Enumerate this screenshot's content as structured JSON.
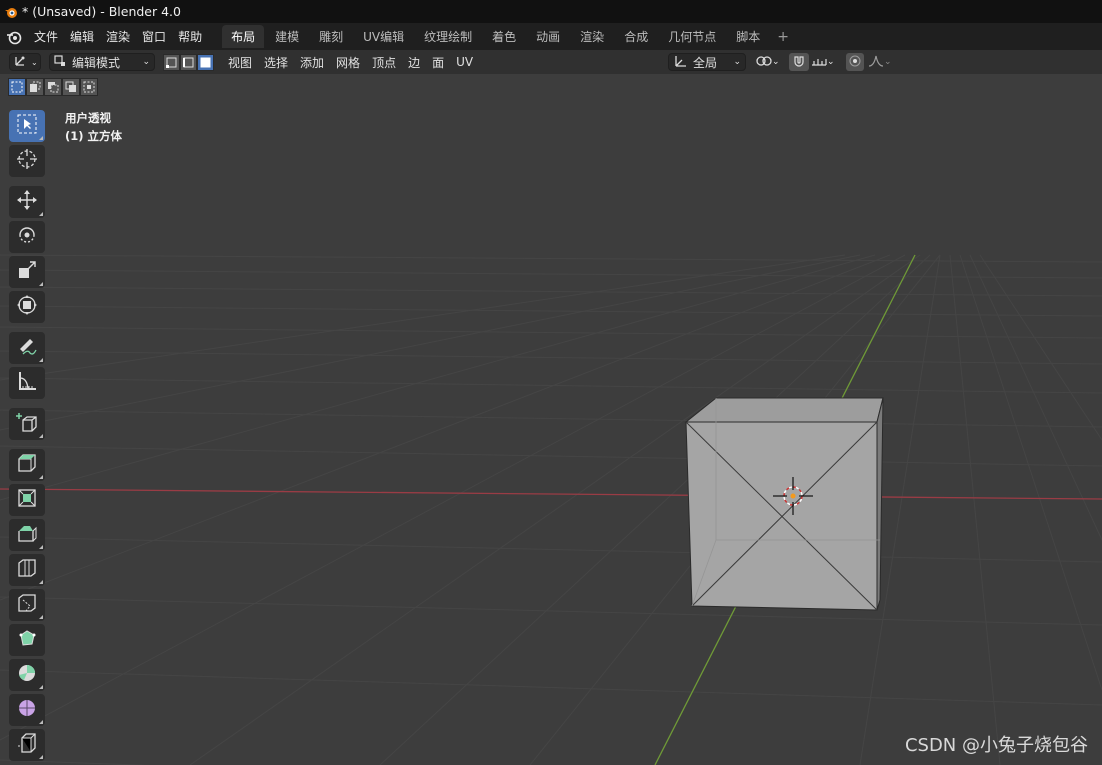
{
  "window": {
    "title": "* (Unsaved) - Blender 4.0"
  },
  "menubar": {
    "menus": [
      "文件",
      "编辑",
      "渲染",
      "窗口",
      "帮助"
    ],
    "tabs": [
      "布局",
      "建模",
      "雕刻",
      "UV编辑",
      "纹理绘制",
      "着色",
      "动画",
      "渲染",
      "合成",
      "几何节点",
      "脚本"
    ],
    "active_tab": "布局",
    "add_tab": "+"
  },
  "header": {
    "mode": "编辑模式",
    "menus": [
      "视图",
      "选择",
      "添加",
      "网格",
      "顶点",
      "边",
      "面",
      "UV"
    ],
    "transform_orientation": "全局"
  },
  "viewport": {
    "overlay_line1": "用户透视",
    "overlay_line2": "(1) 立方体",
    "watermark": "CSDN @小兔子烧包谷"
  },
  "colors": {
    "accent": "#4772b3",
    "x_axis": "#9a3c45",
    "y_axis": "#6f9a37",
    "viewport_bg": "#3d3d3d",
    "tool_icon_green": "#7fd3a8"
  },
  "toolbar_tools": [
    "select-box",
    "cursor",
    "move",
    "rotate",
    "scale",
    "transform",
    "annotate",
    "measure",
    "add-cube",
    "extrude",
    "inset",
    "bevel",
    "loop-cut",
    "knife",
    "poly-build",
    "spin",
    "smooth",
    "shear"
  ]
}
